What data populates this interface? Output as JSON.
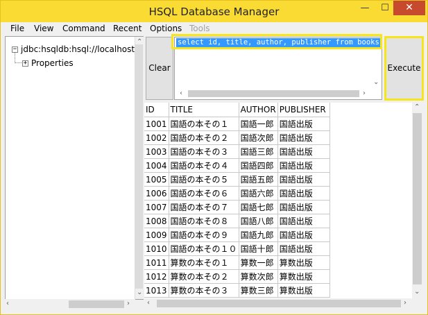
{
  "window": {
    "title": "HSQL Database Manager",
    "min_glyph": "—",
    "max_glyph": "☐",
    "close_glyph": "✕"
  },
  "menu": [
    "File",
    "View",
    "Command",
    "Recent",
    "Options",
    "Tools"
  ],
  "menu_disabled": [
    "Tools"
  ],
  "tree": {
    "root_label": "jdbc:hsqldb:hsql://localhost/",
    "child_label": "Properties",
    "root_expander": "−",
    "child_expander": "+"
  },
  "query": {
    "clear_label": "Clear",
    "execute_label": "Execute",
    "sql_text": "select id, title, author, publisher from books"
  },
  "results": {
    "columns": [
      "ID",
      "TITLE",
      "AUTHOR",
      "PUBLISHER"
    ],
    "rows": [
      [
        "1001",
        "国語の本その１",
        "国語一郎",
        "国語出版"
      ],
      [
        "1002",
        "国語の本その２",
        "国語次郎",
        "国語出版"
      ],
      [
        "1003",
        "国語の本その３",
        "国語三郎",
        "国語出版"
      ],
      [
        "1004",
        "国語の本その４",
        "国語四郎",
        "国語出版"
      ],
      [
        "1005",
        "国語の本その５",
        "国語五郎",
        "国語出版"
      ],
      [
        "1006",
        "国語の本その６",
        "国語六郎",
        "国語出版"
      ],
      [
        "1007",
        "国語の本その７",
        "国語七郎",
        "国語出版"
      ],
      [
        "1008",
        "国語の本その８",
        "国語八郎",
        "国語出版"
      ],
      [
        "1009",
        "国語の本その９",
        "国語九郎",
        "国語出版"
      ],
      [
        "1010",
        "国語の本その１０",
        "国語十郎",
        "国語出版"
      ],
      [
        "1011",
        "算数の本その１",
        "算数一郎",
        "算数出版"
      ],
      [
        "1012",
        "算数の本その２",
        "算数次郎",
        "算数出版"
      ],
      [
        "1013",
        "算数の本その３",
        "算数三郎",
        "算数出版"
      ]
    ]
  },
  "colors": {
    "titlebar": "#fadb34",
    "close": "#c74a2f",
    "highlight": "#f5e51a",
    "selection": "#3399ff"
  }
}
